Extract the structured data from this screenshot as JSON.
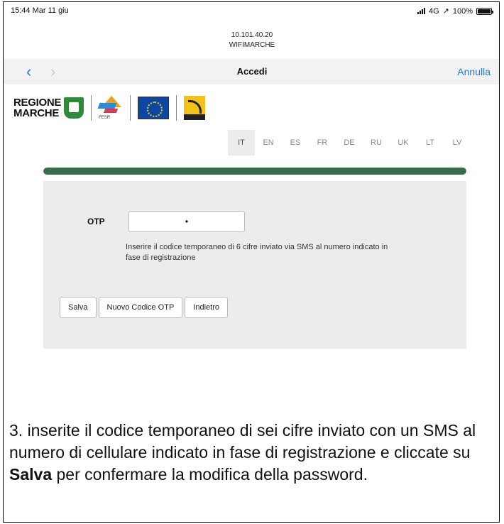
{
  "status": {
    "time": "15:44",
    "date": "Mar 11 giu",
    "network": "4G",
    "location_arrow": "↗",
    "battery": "100%",
    "battery_level": 1.0
  },
  "address": {
    "ip": "10.101.40.20",
    "ssid": "WIFIMARCHE"
  },
  "navbar": {
    "back_icon": "‹",
    "forward_icon": "›",
    "title": "Accedi",
    "cancel": "Annulla"
  },
  "logos": {
    "regione_line1": "REGIONE",
    "regione_line2": "MARCHE",
    "fesr_label": "FESR"
  },
  "languages": [
    "IT",
    "EN",
    "ES",
    "FR",
    "DE",
    "RU",
    "UK",
    "LT",
    "LV"
  ],
  "selected_language": "IT",
  "progress": {
    "fraction": 1.0,
    "color": "#3a6b4f"
  },
  "form": {
    "otp_label": "OTP",
    "otp_value": "•",
    "hint": "Inserire il codice temporaneo di 6 cifre inviato via SMS al numero indicato in fase di registrazione",
    "buttons": {
      "save": "Salva",
      "new_code": "Nuovo Codice OTP",
      "back": "Indietro"
    }
  },
  "caption": {
    "before": "3. inserite il codice temporaneo di sei cifre inviato con un SMS al numero di cellulare indicato in fase di registrazione e cliccate su ",
    "bold": "Salva",
    "after": " per confermare la modifica della password."
  },
  "colors": {
    "accent_blue": "#1a7bd8",
    "progress_green": "#3a6b4f",
    "panel_gray": "#ececec"
  }
}
